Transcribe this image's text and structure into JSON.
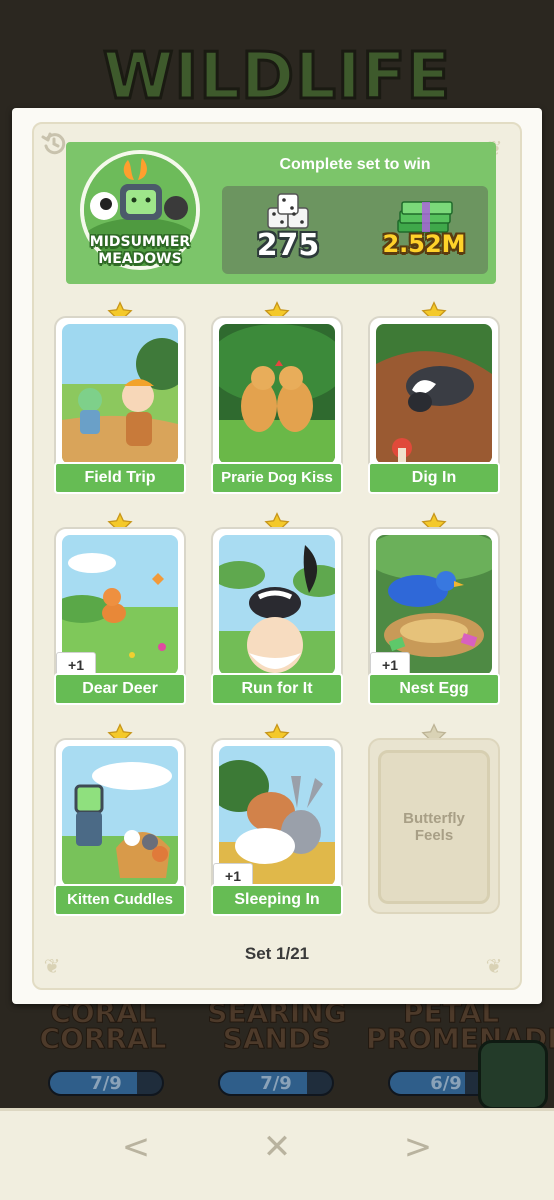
{
  "album_title": "WILDLIFE",
  "set": {
    "name": "MIDSUMMER MEADOWS",
    "reward_label": "Complete set to win",
    "reward_dice": "275",
    "reward_cash": "2.52M",
    "counter": "Set 1/21"
  },
  "cards": [
    {
      "title": "Field Trip",
      "duplicate": "",
      "collected": true
    },
    {
      "title": "Prarie Dog Kiss",
      "duplicate": "",
      "collected": true
    },
    {
      "title": "Dig In",
      "duplicate": "",
      "collected": true
    },
    {
      "title": "Dear Deer",
      "duplicate": "+1",
      "collected": true
    },
    {
      "title": "Run for It",
      "duplicate": "",
      "collected": true
    },
    {
      "title": "Nest Egg",
      "duplicate": "+1",
      "collected": true
    },
    {
      "title": "Kitten Cuddles",
      "duplicate": "",
      "collected": true
    },
    {
      "title": "Sleeping In",
      "duplicate": "+1",
      "collected": true
    },
    {
      "title": "Butterfly Feels",
      "duplicate": "",
      "collected": false
    }
  ],
  "background_sets": [
    {
      "name": "CORAL CORRAL",
      "progress": "7/9",
      "fraction": 0.78
    },
    {
      "name": "SEARING SANDS",
      "progress": "7/9",
      "fraction": 0.78
    },
    {
      "name": "PETAL PROMENADE",
      "progress": "6/9",
      "fraction": 0.67
    }
  ],
  "nav": {
    "prev": "<",
    "close": "✕",
    "next": ">"
  },
  "colors": {
    "header_green": "#7cc56a",
    "label_green": "#66bc54",
    "star_gold": "#f4c92a",
    "missing_card": "#e9e4d0"
  },
  "icons": [
    "history-icon",
    "dice-icon",
    "cash-stack-icon",
    "star-icon",
    "chevron-left-icon",
    "close-icon",
    "chevron-right-icon"
  ]
}
